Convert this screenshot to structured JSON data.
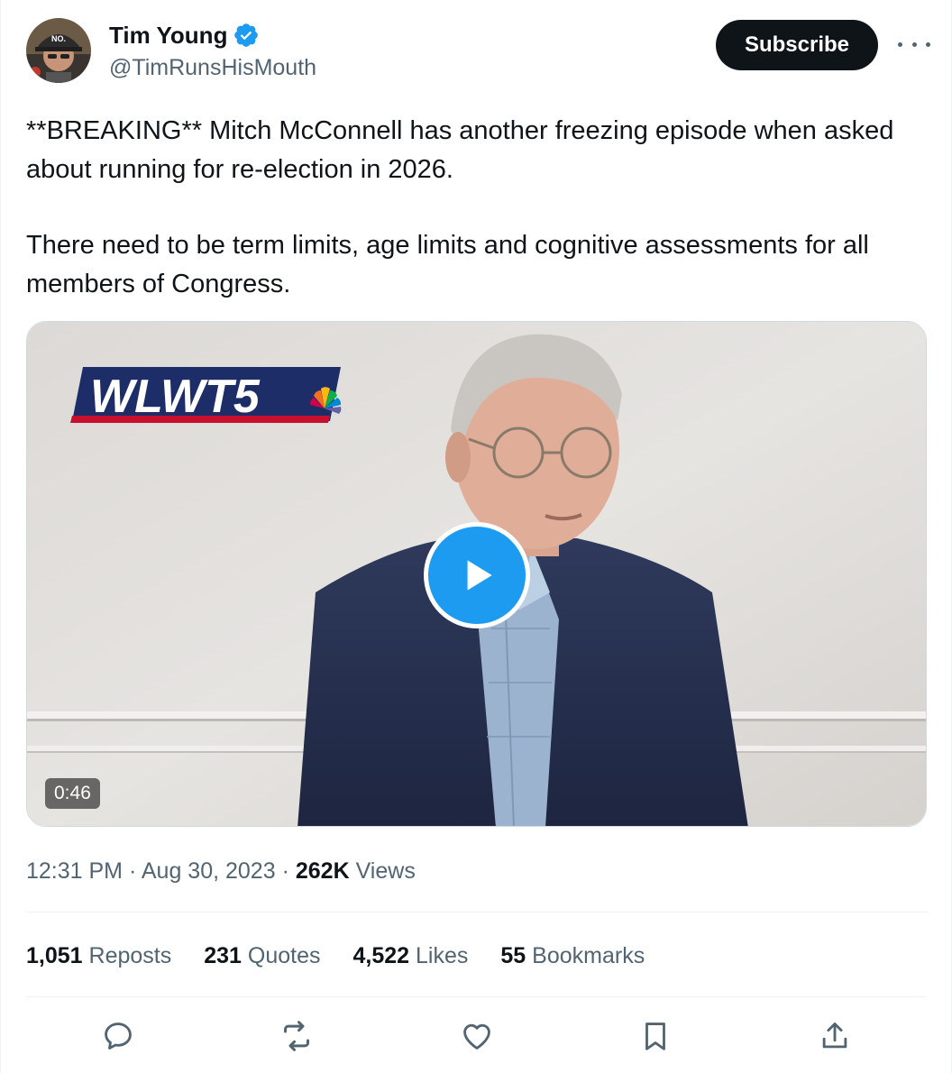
{
  "author": {
    "display_name": "Tim Young",
    "handle": "@TimRunsHisMouth",
    "verified_icon": "verified-badge-icon",
    "avatar_cap_text": "NO."
  },
  "header": {
    "subscribe_label": "Subscribe",
    "more_icon": "more-options-icon"
  },
  "tweet": {
    "paragraphs": [
      "**BREAKING** Mitch McConnell has another freezing episode when asked about running for re-election in 2026.",
      "There need to be term limits, age limits and cognitive assessments for all members of Congress."
    ]
  },
  "media": {
    "logo_text": "WLWT5",
    "duration": "0:46",
    "play_icon": "play-icon"
  },
  "meta": {
    "time": "12:31 PM",
    "separator": "·",
    "date": "Aug 30, 2023",
    "views_count": "262K",
    "views_label": "Views"
  },
  "stats": [
    {
      "count": "1,051",
      "label": "Reposts"
    },
    {
      "count": "231",
      "label": "Quotes"
    },
    {
      "count": "4,522",
      "label": "Likes"
    },
    {
      "count": "55",
      "label": "Bookmarks"
    }
  ],
  "actions": [
    "reply-icon",
    "repost-icon",
    "like-icon",
    "bookmark-icon",
    "share-icon"
  ],
  "colors": {
    "accent": "#1d9bf0",
    "text_primary": "#0f1419",
    "text_secondary": "#536471",
    "button_dark": "#0f1419"
  }
}
